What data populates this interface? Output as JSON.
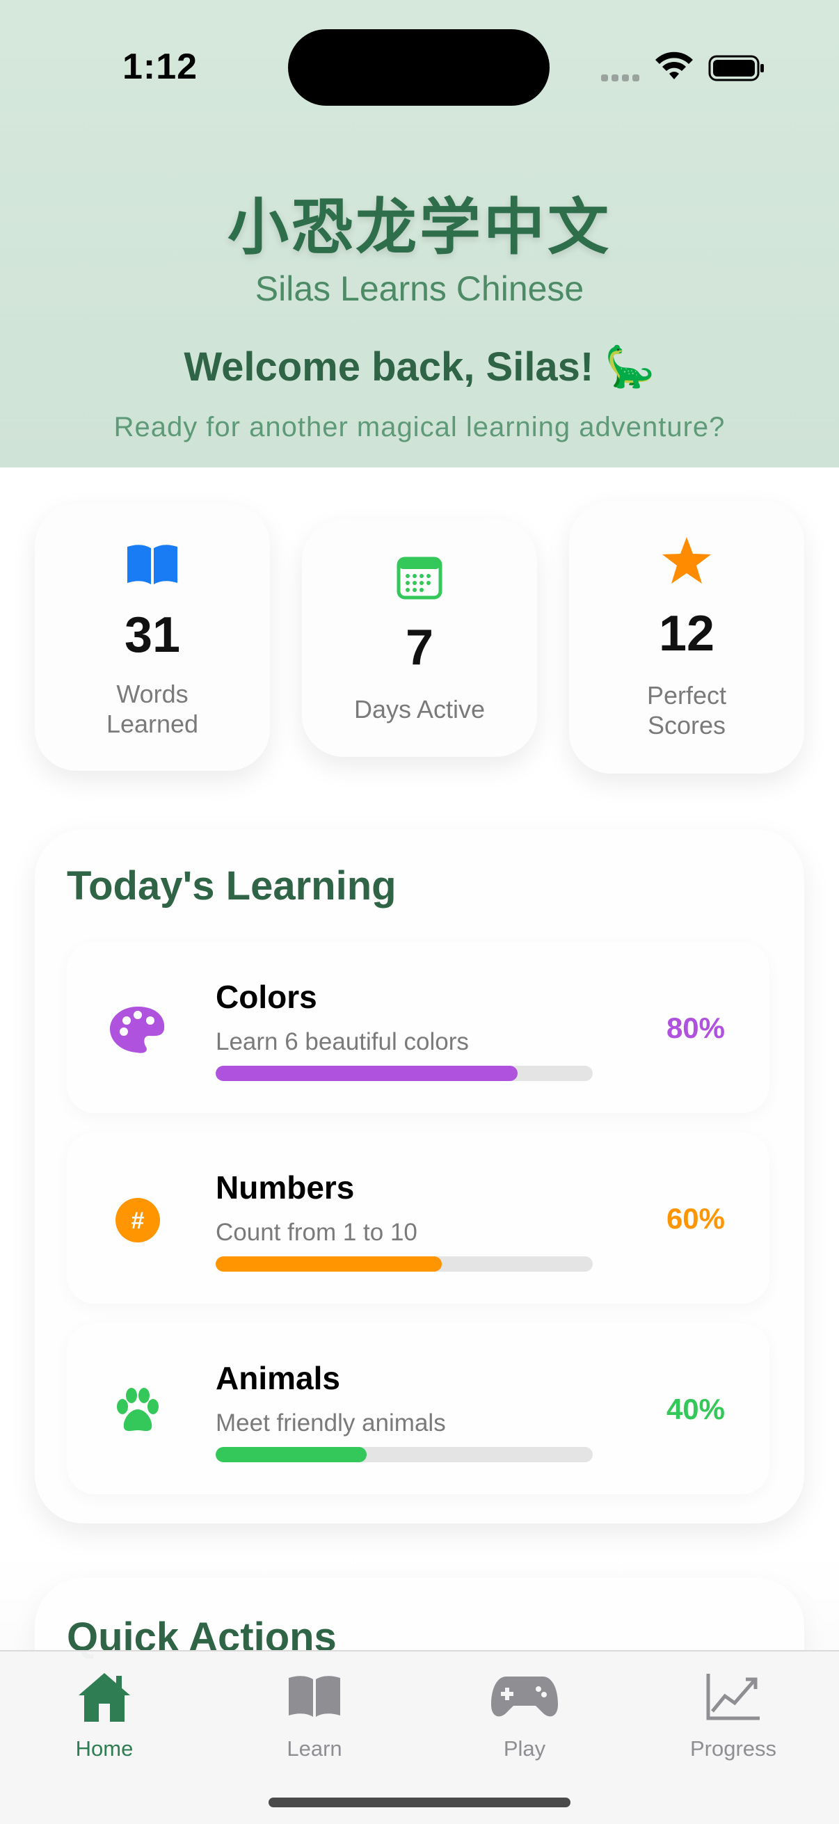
{
  "status_bar": {
    "time": "1:12"
  },
  "header": {
    "title": "小恐龙学中文",
    "subtitle": "Silas Learns Chinese",
    "welcome": "Welcome back, Silas! 🦕",
    "tagline": "Ready for another magical learning adventure?"
  },
  "stats": [
    {
      "value": "31",
      "label_line1": "Words",
      "label_line2": "Learned",
      "icon": "book-icon",
      "color": "#1a7cf5"
    },
    {
      "value": "7",
      "label_line1": "Days Active",
      "label_line2": "",
      "icon": "calendar-icon",
      "color": "#34c759"
    },
    {
      "value": "12",
      "label_line1": "Perfect",
      "label_line2": "Scores",
      "icon": "star-icon",
      "color": "#ff8c00"
    }
  ],
  "learning": {
    "title": "Today's Learning",
    "lessons": [
      {
        "name": "Colors",
        "desc": "Learn 6 beautiful colors",
        "percent": "80%",
        "progress": 0.8,
        "color": "#af52de",
        "icon": "palette-icon"
      },
      {
        "name": "Numbers",
        "desc": "Count from 1 to 10",
        "percent": "60%",
        "progress": 0.6,
        "color": "#ff9500",
        "icon": "number-sign-icon"
      },
      {
        "name": "Animals",
        "desc": "Meet friendly animals",
        "percent": "40%",
        "progress": 0.4,
        "color": "#34c759",
        "icon": "paw-icon"
      }
    ]
  },
  "quick_actions": {
    "title": "Quick Actions"
  },
  "tabs": [
    {
      "label": "Home",
      "icon": "house-icon",
      "active": true
    },
    {
      "label": "Learn",
      "icon": "book-icon",
      "active": false
    },
    {
      "label": "Play",
      "icon": "gamecontroller-icon",
      "active": false
    },
    {
      "label": "Progress",
      "icon": "chart-icon",
      "active": false
    }
  ],
  "colors": {
    "accent": "#2f7d52",
    "tab_inactive": "#8e8e93",
    "title_green": "#2f6446"
  }
}
